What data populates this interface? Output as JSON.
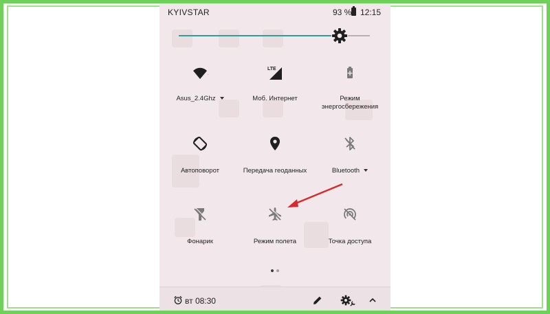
{
  "status_bar": {
    "carrier": "KYIVSTAR",
    "battery": "93 %",
    "time": "12:15"
  },
  "brightness": {
    "level": 0.84
  },
  "tiles": [
    {
      "id": "wifi",
      "label": "Asus_2.4Ghz",
      "icon": "wifi-icon",
      "has_dropdown": true
    },
    {
      "id": "mobile-data",
      "label": "Моб. Интернет",
      "icon": "lte-signal-icon",
      "has_dropdown": false
    },
    {
      "id": "battery-saver",
      "label": "Режим энергосбережения",
      "icon": "battery-saver-icon",
      "has_dropdown": false
    },
    {
      "id": "auto-rotate",
      "label": "Автоповорот",
      "icon": "auto-rotate-icon",
      "has_dropdown": false
    },
    {
      "id": "location",
      "label": "Передача геоданных",
      "icon": "location-pin-icon",
      "has_dropdown": false
    },
    {
      "id": "bluetooth",
      "label": "Bluetooth",
      "icon": "bluetooth-off-icon",
      "has_dropdown": true
    },
    {
      "id": "flashlight",
      "label": "Фонарик",
      "icon": "flashlight-off-icon",
      "has_dropdown": false
    },
    {
      "id": "airplane-mode",
      "label": "Режим полета",
      "icon": "airplane-off-icon",
      "has_dropdown": false
    },
    {
      "id": "hotspot",
      "label": "Точка доступа",
      "icon": "hotspot-off-icon",
      "has_dropdown": false
    }
  ],
  "pager": {
    "pages": 2,
    "active": 1
  },
  "bottom_bar": {
    "alarm": "вт 08:30",
    "icons": [
      "edit-pencil-icon",
      "settings-gear-icon",
      "collapse-chevron-icon"
    ]
  },
  "colors": {
    "panel_bg": "#f2e7ea",
    "accent": "#2d9c9a",
    "icon_dark": "#1f1f1f",
    "icon_muted": "#7a7a7a",
    "annotation_arrow": "#d92a2a",
    "frame_green": "#6fd05a"
  }
}
